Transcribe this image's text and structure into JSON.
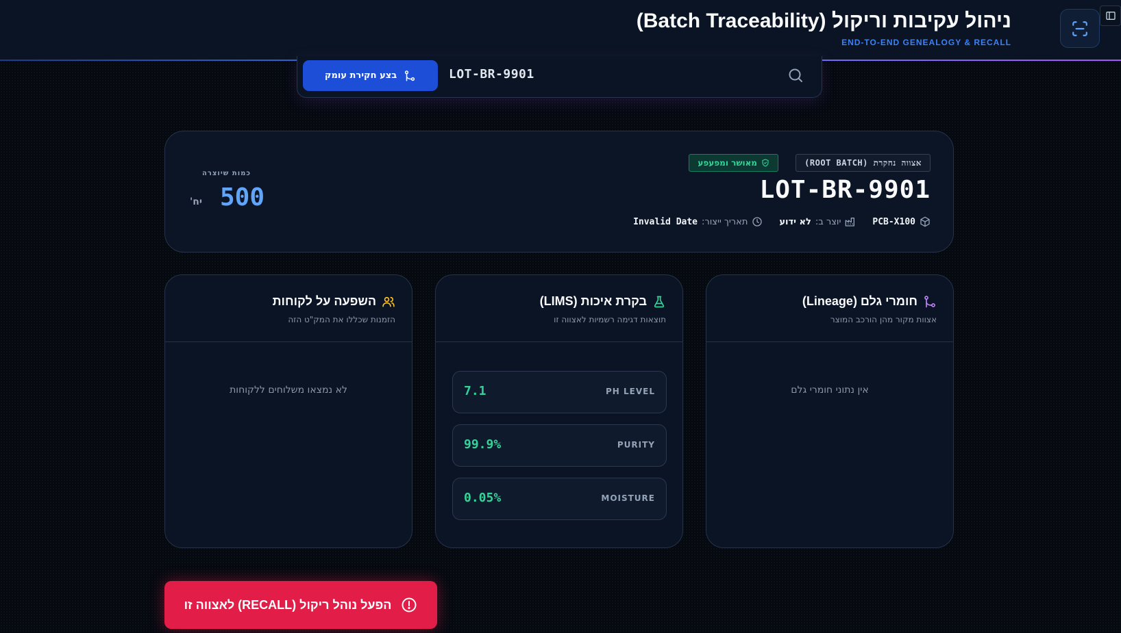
{
  "header": {
    "title": "ניהול עקיבות וריקול (Batch Traceability)",
    "subtitle": "END-TO-END GENEALOGY & RECALL",
    "accent": "#3b82f6"
  },
  "search": {
    "value": "LOT-BR-9901",
    "button_label": "בצע חקירת עומק"
  },
  "batch": {
    "root_badge": "אצווה נחקרת (ROOT BATCH)",
    "status_badge": "מאושר ומפעפע",
    "id": "LOT-BR-9901",
    "product": "PCB-X100",
    "manufactured_by_label": "יוצר ב:",
    "manufactured_by_value": "לא ידוע",
    "date_label": "תאריך ייצור:",
    "date_value": "Invalid Date",
    "quantity_label": "כמות שיוצרה",
    "quantity": "500",
    "unit": "יח'"
  },
  "panels": {
    "lineage": {
      "title": "חומרי גלם (Lineage)",
      "subtitle": "אצוות מקור מהן הורכב המוצר",
      "empty": "אין נתוני חומרי גלם",
      "icon": "git-branch-icon"
    },
    "quality": {
      "title": "בקרת איכות (LIMS)",
      "subtitle": "תוצאות דגימה רשמיות לאצווה זו",
      "icon": "flask-icon",
      "metrics": [
        {
          "name": "PH LEVEL",
          "value": "7.1"
        },
        {
          "name": "PURITY",
          "value": "99.9%"
        },
        {
          "name": "MOISTURE",
          "value": "0.05%"
        }
      ]
    },
    "customers": {
      "title": "השפעה על לקוחות",
      "subtitle": "הזמנות שכללו את המק\"ט הזה",
      "empty": "לא נמצאו משלוחים ללקוחות",
      "icon": "users-icon"
    }
  },
  "recall": {
    "label": "הפעל נוהל ריקול (RECALL) לאצווה זו",
    "color": "#e11d48"
  }
}
